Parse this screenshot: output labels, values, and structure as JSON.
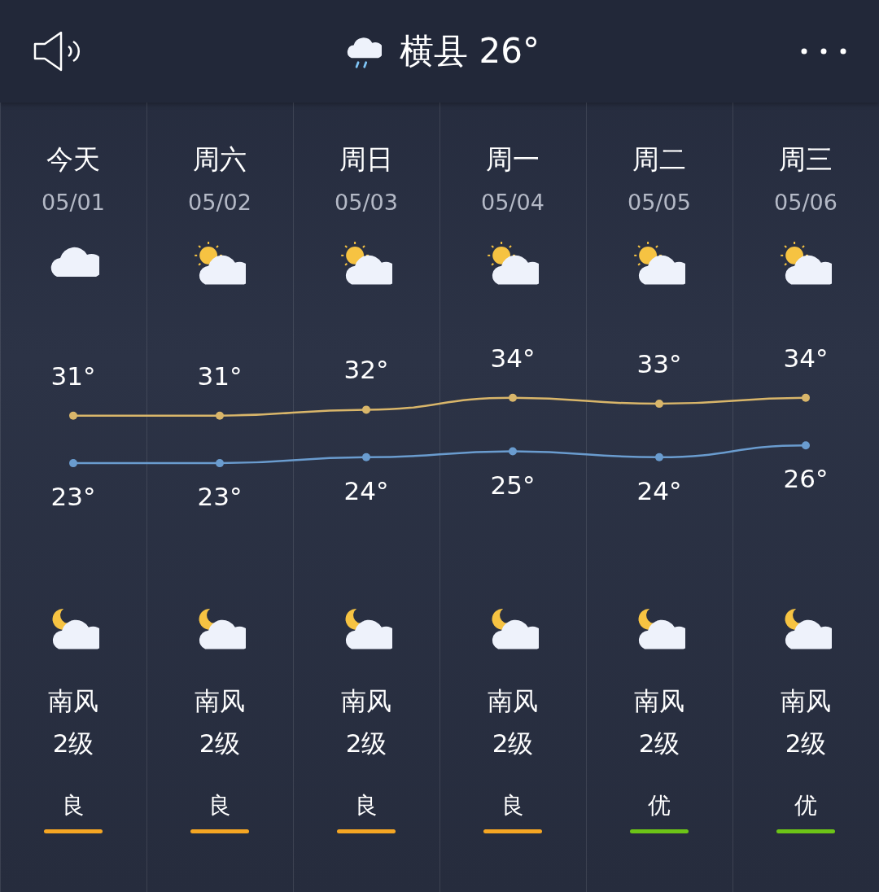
{
  "header": {
    "location": "横县",
    "temperature": "26°"
  },
  "days": [
    {
      "day": "今天",
      "date": "05/01",
      "kind": "cloudy",
      "wind": "南风",
      "wind_level": "2级",
      "aqi": "良",
      "color": "#f5a623"
    },
    {
      "day": "周六",
      "date": "05/02",
      "kind": "partly-cloudy",
      "wind": "南风",
      "wind_level": "2级",
      "aqi": "良",
      "color": "#f5a623"
    },
    {
      "day": "周日",
      "date": "05/03",
      "kind": "partly-cloudy",
      "wind": "南风",
      "wind_level": "2级",
      "aqi": "良",
      "color": "#f5a623"
    },
    {
      "day": "周一",
      "date": "05/04",
      "kind": "partly-cloudy",
      "wind": "南风",
      "wind_level": "2级",
      "aqi": "良",
      "color": "#f5a623"
    },
    {
      "day": "周二",
      "date": "05/05",
      "kind": "partly-cloudy",
      "wind": "南风",
      "wind_level": "2级",
      "aqi": "优",
      "color": "#6cc417"
    },
    {
      "day": "周三",
      "date": "05/06",
      "kind": "partly-cloudy",
      "wind": "南风",
      "wind_level": "2级",
      "aqi": "优",
      "color": "#6cc417"
    }
  ],
  "chart_data": {
    "type": "line",
    "series": [
      {
        "color": "#d9b66a",
        "marker": true,
        "values": [
          31,
          31,
          32,
          34,
          33,
          34
        ],
        "value_labels": [
          "31°",
          "31°",
          "32°",
          "34°",
          "33°",
          "34°"
        ]
      },
      {
        "color": "#6a9ccf",
        "marker": true,
        "values": [
          23,
          23,
          24,
          25,
          24,
          26
        ],
        "value_labels": [
          "23°",
          "23°",
          "24°",
          "25°",
          "24°",
          "26°"
        ]
      }
    ]
  }
}
